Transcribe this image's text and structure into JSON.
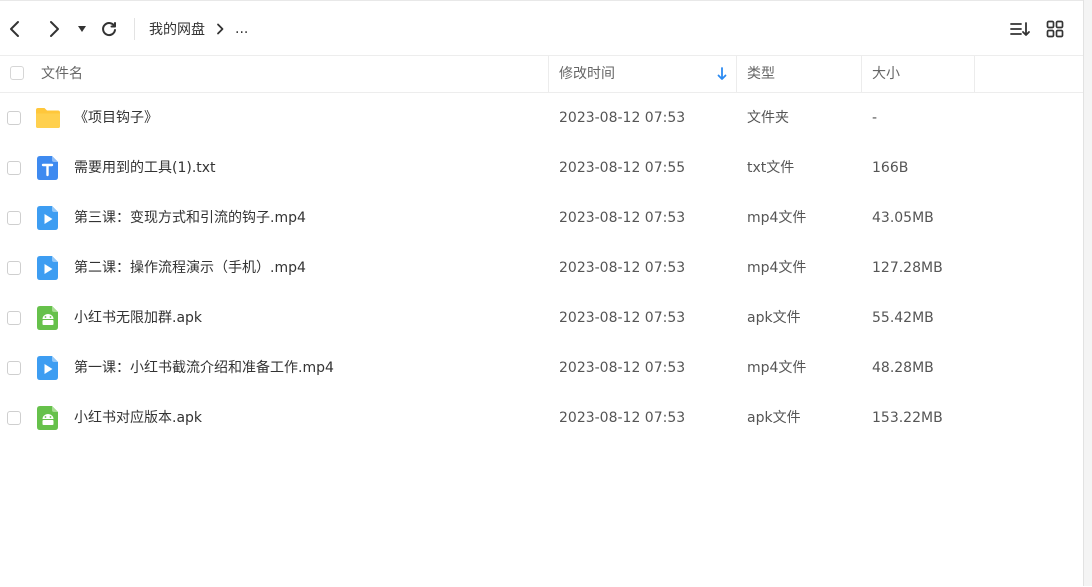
{
  "toolbar": {
    "breadcrumb": [
      "我的网盘",
      "..."
    ]
  },
  "table": {
    "columns": {
      "name": "文件名",
      "modified": "修改时间",
      "type": "类型",
      "size": "大小"
    },
    "sorted_by": "modified",
    "rows": [
      {
        "name": "《项目钩子》",
        "modified": "2023-08-12 07:53",
        "type": "文件夹",
        "size": "-",
        "icon": "folder-icon"
      },
      {
        "name": "需要用到的工具(1).txt",
        "modified": "2023-08-12 07:55",
        "type": "txt文件",
        "size": "166B",
        "icon": "txt-file-icon"
      },
      {
        "name": "第三课：变现方式和引流的钩子.mp4",
        "modified": "2023-08-12 07:53",
        "type": "mp4文件",
        "size": "43.05MB",
        "icon": "video-file-icon"
      },
      {
        "name": "第二课：操作流程演示（手机）.mp4",
        "modified": "2023-08-12 07:53",
        "type": "mp4文件",
        "size": "127.28MB",
        "icon": "video-file-icon"
      },
      {
        "name": "小红书无限加群.apk",
        "modified": "2023-08-12 07:53",
        "type": "apk文件",
        "size": "55.42MB",
        "icon": "apk-file-icon"
      },
      {
        "name": "第一课：小红书截流介绍和准备工作.mp4",
        "modified": "2023-08-12 07:53",
        "type": "mp4文件",
        "size": "48.28MB",
        "icon": "video-file-icon"
      },
      {
        "name": "小红书对应版本.apk",
        "modified": "2023-08-12 07:53",
        "type": "apk文件",
        "size": "153.22MB",
        "icon": "apk-file-icon"
      }
    ]
  },
  "colors": {
    "folder": "#FFC73B",
    "txt": "#3E8AF0",
    "video": "#3D9DF2",
    "apk": "#66C14B",
    "sort_arrow": "#2B8BF2"
  }
}
